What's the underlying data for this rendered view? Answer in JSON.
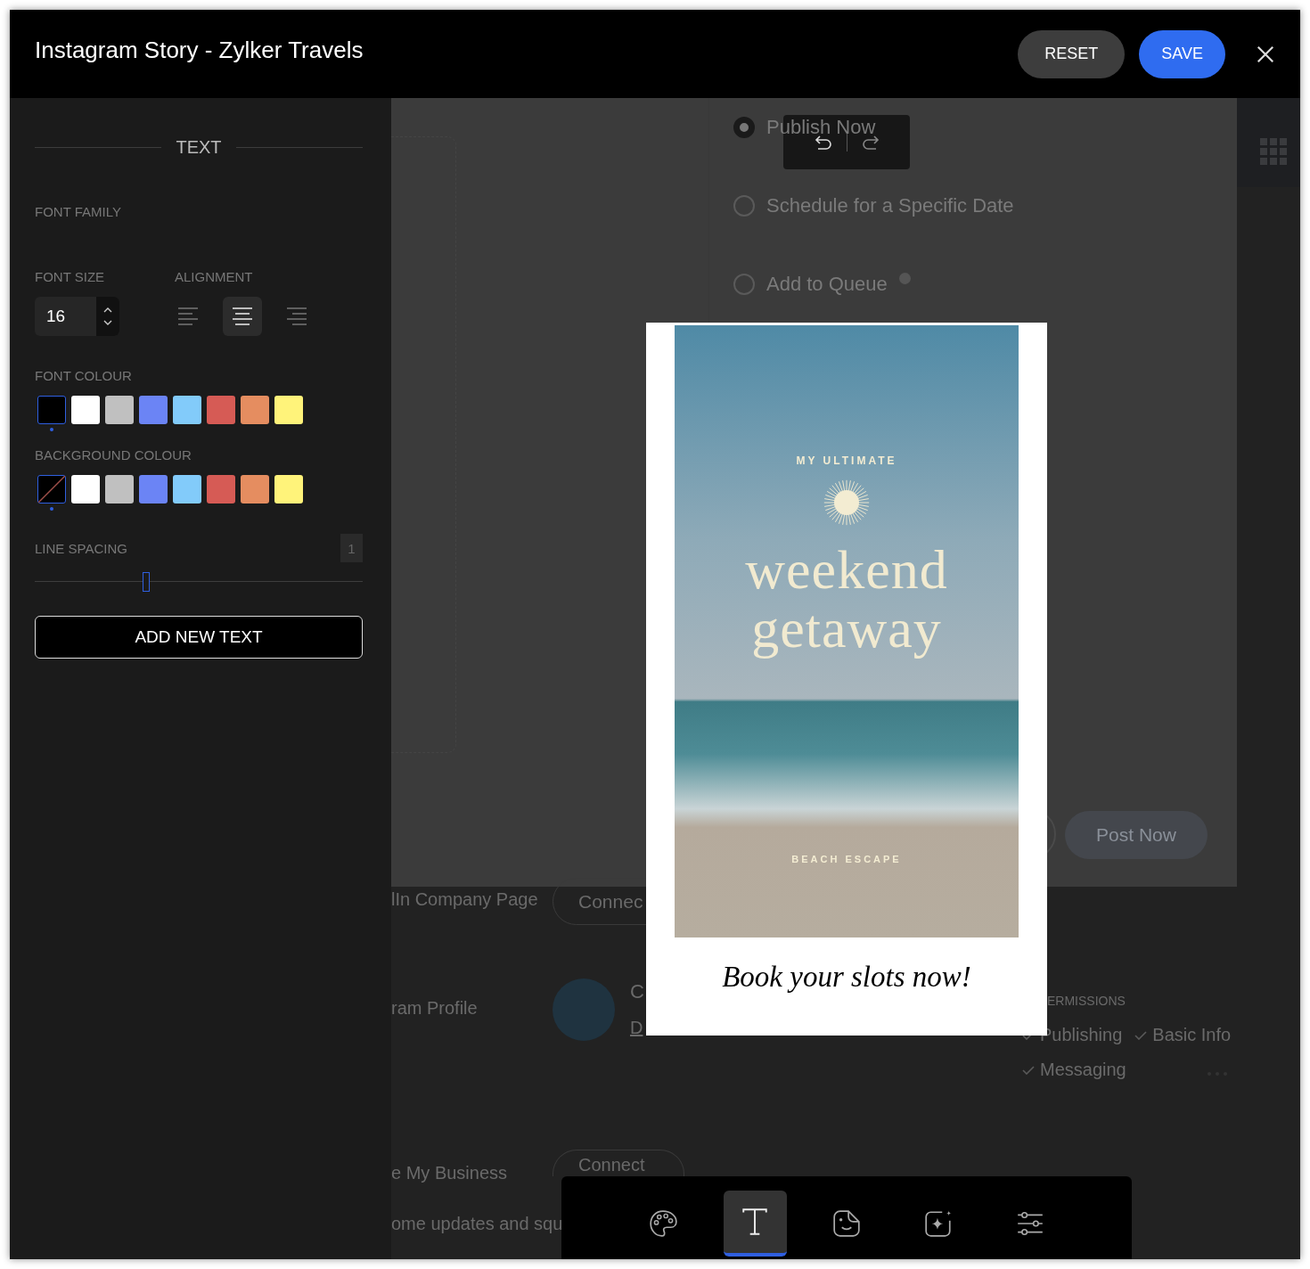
{
  "window": {
    "title": "Instagram Story - Zylker Travels"
  },
  "header_buttons": [
    {
      "label": "RESET",
      "kind": "secondary"
    },
    {
      "label": "SAVE",
      "kind": "primary"
    }
  ],
  "panel": {
    "title": "TEXT",
    "font_family_label": "FONT FAMILY",
    "font_size_label": "FONT SIZE",
    "font_size": "16",
    "alignment_label": "ALIGNMENT",
    "alignments": [
      {
        "kind": "left",
        "selected": false
      },
      {
        "kind": "center",
        "selected": true
      },
      {
        "kind": "right",
        "selected": false
      }
    ],
    "font_colour_label": "FONT COLOUR",
    "font_colours": [
      {
        "color": "#000000",
        "selected": true
      },
      {
        "color": "#ffffff",
        "selected": false
      },
      {
        "color": "#c0c0c0",
        "selected": false
      },
      {
        "color": "#6b84f5",
        "selected": false
      },
      {
        "color": "#82cbfa",
        "selected": false
      },
      {
        "color": "#d65b55",
        "selected": false
      },
      {
        "color": "#e58d60",
        "selected": false
      },
      {
        "color": "#fff37a",
        "selected": false
      }
    ],
    "background_colour_label": "BACKGROUND COLOUR",
    "background_colours": [
      {
        "kind": "none",
        "selected": true
      },
      {
        "kind": "color",
        "color": "#ffffff",
        "selected": false
      },
      {
        "kind": "color",
        "color": "#c0c0c0",
        "selected": false
      },
      {
        "kind": "color",
        "color": "#6b84f5",
        "selected": false
      },
      {
        "kind": "color",
        "color": "#82cbfa",
        "selected": false
      },
      {
        "kind": "color",
        "color": "#d65b55",
        "selected": false
      },
      {
        "kind": "color",
        "color": "#e58d60",
        "selected": false
      },
      {
        "kind": "color",
        "color": "#fff37a",
        "selected": false
      }
    ],
    "line_spacing_label": "LINE SPACING",
    "line_spacing": {
      "reading": "1",
      "level": 0.34
    },
    "add_button": "ADD NEW TEXT"
  },
  "story": {
    "kicker": "MY ULTIMATE",
    "headline": [
      "weekend",
      "getaway"
    ],
    "tagline": "BEACH ESCAPE",
    "caption": "Book your slots now!"
  },
  "history_toolbar": [
    {
      "kind": "undo",
      "disabled": false
    },
    {
      "kind": "redo",
      "disabled": true
    }
  ],
  "tools": [
    {
      "kind": "palette",
      "selected": false
    },
    {
      "kind": "text",
      "selected": true
    },
    {
      "kind": "sticker",
      "selected": false
    },
    {
      "kind": "sparkle",
      "selected": false
    },
    {
      "kind": "sliders",
      "selected": false
    }
  ],
  "background": {
    "publish_options": [
      {
        "label": "Publish Now",
        "selected": true,
        "help": false
      },
      {
        "label": "Schedule for a Specific Date",
        "selected": false,
        "help": false
      },
      {
        "label": "Add to Queue",
        "selected": false,
        "help": true
      }
    ],
    "post_button": "Post Now",
    "company_page": {
      "label": "lIn Company Page",
      "button": "Connec"
    },
    "profile": {
      "label": "ram Profile",
      "line_1": "C",
      "line_2": "D",
      "permissions_label": "ERMISSIONS",
      "permissions": [
        "Publishing",
        "Basic Info",
        "Messaging"
      ]
    },
    "business": {
      "label": "e My Business",
      "button": "Connect"
    },
    "note": "ome updates and squ"
  }
}
